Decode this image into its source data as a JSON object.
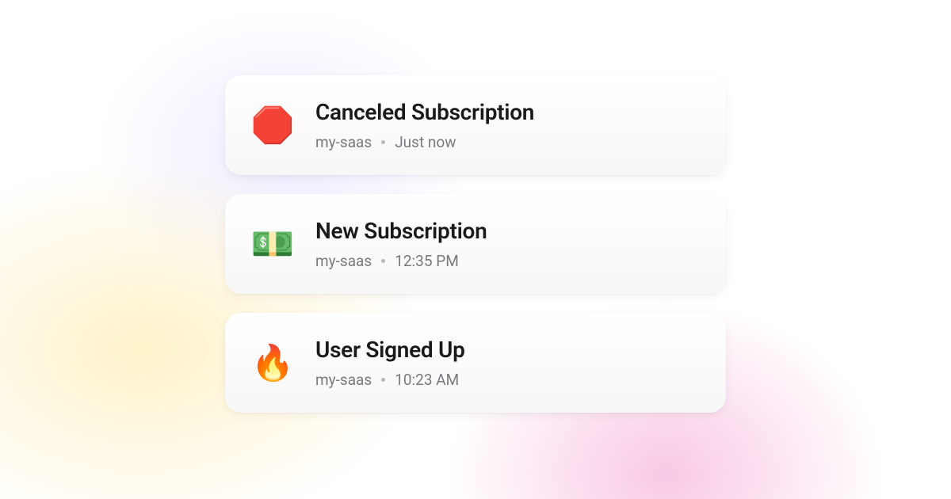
{
  "notifications": [
    {
      "icon": "🛑",
      "icon_name": "stop-sign-icon",
      "title": "Canceled Subscription",
      "source": "my-saas",
      "time": "Just now"
    },
    {
      "icon": "💵",
      "icon_name": "money-icon",
      "title": "New Subscription",
      "source": "my-saas",
      "time": "12:35 PM"
    },
    {
      "icon": "🔥",
      "icon_name": "fire-icon",
      "title": "User Signed Up",
      "source": "my-saas",
      "time": "10:23 AM"
    }
  ]
}
